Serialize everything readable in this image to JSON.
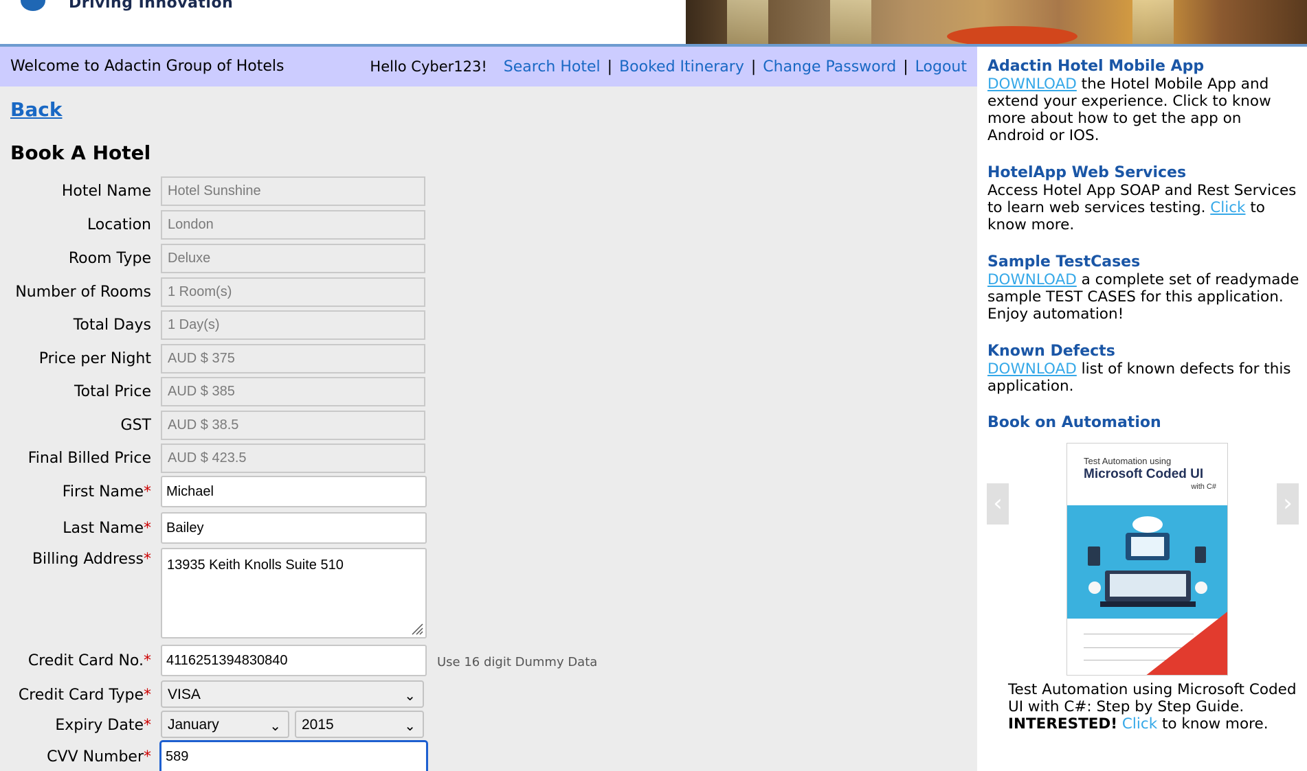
{
  "header": {
    "tagline": "Driving Innovation"
  },
  "welcome_bar": {
    "welcome_text": "Welcome to Adactin Group of Hotels",
    "greeting": "Hello Cyber123!",
    "links": {
      "search_hotel": "Search Hotel",
      "booked_itinerary": "Booked Itinerary",
      "change_password": "Change Password",
      "logout": "Logout"
    },
    "separator": "|"
  },
  "main": {
    "back_link": "Back",
    "form_title": "Book A Hotel",
    "readonly_fields": [
      {
        "label": "Hotel Name",
        "value": "Hotel Sunshine"
      },
      {
        "label": "Location",
        "value": "London"
      },
      {
        "label": "Room Type",
        "value": "Deluxe"
      },
      {
        "label": "Number of Rooms",
        "value": "1 Room(s)"
      },
      {
        "label": "Total Days",
        "value": "1 Day(s)"
      },
      {
        "label": "Price per Night",
        "value": "AUD $ 375"
      },
      {
        "label": "Total Price",
        "value": "AUD $ 385"
      },
      {
        "label": "GST",
        "value": "AUD $ 38.5"
      },
      {
        "label": "Final Billed Price",
        "value": "AUD $ 423.5"
      }
    ],
    "required_marker": "*",
    "first_name": {
      "label": "First Name",
      "value": "Michael"
    },
    "last_name": {
      "label": "Last Name",
      "value": "Bailey"
    },
    "billing_address": {
      "label": "Billing Address",
      "value": "13935 Keith Knolls Suite 510"
    },
    "credit_card_no": {
      "label": "Credit Card No.",
      "value": "4116251394830840",
      "hint": "Use 16 digit Dummy Data"
    },
    "credit_card_type": {
      "label": "Credit Card Type",
      "selected": "VISA"
    },
    "expiry_date": {
      "label": "Expiry Date",
      "month": "January",
      "year": "2015"
    },
    "cvv": {
      "label": "CVV Number",
      "value": "589"
    }
  },
  "sidebar": {
    "mobile_app": {
      "title": "Adactin Hotel Mobile App",
      "link": "DOWNLOAD",
      "text": " the Hotel Mobile App and extend your experience. Click to know more about how to get the app on Android or IOS."
    },
    "web_services": {
      "title": "HotelApp Web Services",
      "text_before": "Access Hotel App SOAP and Rest Services to learn web services testing. ",
      "link": "Click",
      "text_after": " to know more."
    },
    "test_cases": {
      "title": "Sample TestCases",
      "link": "DOWNLOAD",
      "text": " a complete set of readymade sample TEST CASES for this application. Enjoy automation!"
    },
    "known_defects": {
      "title": "Known Defects",
      "link": "DOWNLOAD",
      "text": " list of known defects for this application."
    },
    "book": {
      "title": "Book on Automation",
      "cover_subtitle": "Test Automation using",
      "cover_title": "Microsoft Coded UI",
      "cover_with": "with C#",
      "caption": "Test Automation using Microsoft Coded UI with C#: Step by Step Guide.",
      "interested": "INTERESTED!",
      "link": "Click",
      "after_link": " to know more."
    }
  },
  "icons": {
    "carousel_prev": "chevron-left-icon",
    "carousel_next": "chevron-right-icon",
    "select_caret": "chevron-down-icon"
  },
  "colors": {
    "welcome_bar_bg": "#ccccff",
    "link_blue": "#1968c4",
    "sidebar_title": "#1a56a6",
    "sidebar_link": "#35a8e8",
    "required": "#cc0000",
    "focus_border": "#1d5fd0"
  }
}
